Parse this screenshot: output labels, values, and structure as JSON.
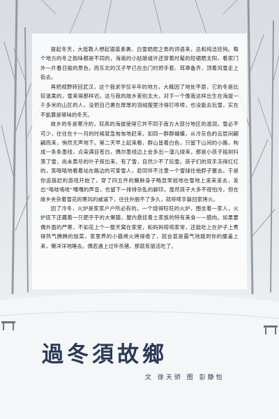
{
  "article": {
    "paragraphs": [
      "提起冬天，大抵教人想起银装素裹、白雪皑皑之类的词语来，总和纯洁挂钩。每个地方的冬之韵味都是不同的，海南的小姑娘或许还穿着时髦的短裙晒太阳，看家门外一片春日般的景色，而东北的汉子早已在出门时把手套、耳罩备齐，顶着风雪走上街去。",
      "再把视野转回武汉，这个我求学仅半年的地方，大概因了地处平原，它的冬是比较温柔的，雪来得那样迟。这与我的故乡差别太大，对于一个像我这样出生在海拔一千多米的山区的人，没把自己裹在厚厚的羽绒服里冷得打哆嗦，也没能去玩雪，实在不能算是够味的冬天。",
      "故乡的冬是寒冷的，较高的海拔使得它并不同于南方大部分地区的温润，雪必不可少，往往在十一月的时候就急匆匆地赶来，如同一群群蝴蝶，从冷灰色的云层间翩翩而来，悄然无声地下。第二天早上起来看，群山皆着白色，只留下山间的小路，构成一条条墨线，点染满目苍白，偶尔墨线边上会多出一溜儿绿来，那是小孩子摇树抖落了雪，尚未黄尽的叶子探出来，有了雪，自然少不了玩雪。孩子们的双手冻得红红的，笑嘻嘻地看着站在路边的可爱雪人，趁同伴不注意一个雪球往他脖子塞去。于是你追我赶的游戏开始了，穿了四五件的臃肿身子略显笨拙地在雪地上滚来滚去，发出“咯吱咯吱”嘎嘎的声音，也留下一排排杂乱的脚印。虽然孩子大多不很怕冷，但在故乡夹杂着雪花的寒风的威逼下，往往外脱不了多久，就哆嗦手躲回家烤火。",
      "因了冷冬，火炉是家家户户所必有的。一个烧得旺旺的火炉，围坐着一家人，火炉底下还藏着一只肥乎乎的大懒猫，屋内悬挂着土家族的特有美食——腊肉。如果要偶外面的严寒，不如花上个一整天窝在家里，和妈妈唠唠家常，还能吃上在炉子上煮得热气腾腾的饭菜，家里养的小猫烤火烤得倦了，就会甚是霸气地跳到你的膝盖上来，懒洋洋地睡去。偶若遇上过年杀猪，那就有丽活吃了。"
    ]
  },
  "title": "過冬須故鄉",
  "credits": "文 徐天骄   图 彭静怡"
}
